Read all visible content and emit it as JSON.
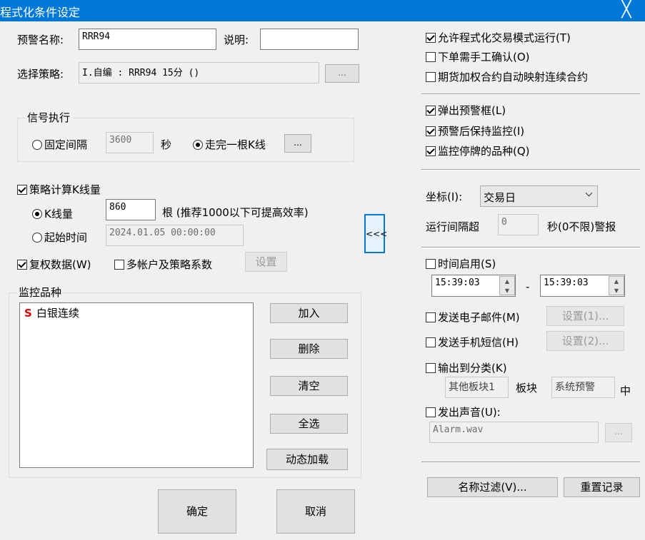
{
  "window": {
    "title": "程式化条件设定",
    "close_glyph": "╳"
  },
  "alert": {
    "name_label": "预警名称:",
    "name_value": "RRR94",
    "desc_label": "说明:",
    "desc_value": "",
    "strategy_label": "选择策略:",
    "strategy_value": "I.自编 : RRR94 15分 ()",
    "browse_label": "..."
  },
  "signal": {
    "group_label": "信号执行",
    "fixed_label": "固定间隔",
    "fixed_value": "3600",
    "unit_sec": "秒",
    "bar_label": "走完一根K线",
    "bar_button": "...",
    "fixed_selected": false,
    "bar_selected": true
  },
  "calc": {
    "checkbox_label": "策略计算K线量",
    "checked": true,
    "kcount_label": "K线量",
    "kcount_value": "860",
    "kcount_hint": "根 (推荐1000以下可提高效率)",
    "kcount_selected": true,
    "start_label": "起始时间",
    "start_value": "2024.01.05 00:00:00",
    "start_selected": false,
    "fq_label": "复权数据(W)",
    "fq_checked": true,
    "multi_label": "多帐户及策略系数",
    "multi_checked": false,
    "settings_label": "设置"
  },
  "monitor": {
    "group_label": "监控品种",
    "items": [
      {
        "badge": "S",
        "name": "白银连续"
      }
    ],
    "add": "加入",
    "delete": "删除",
    "clear": "清空",
    "select_all": "全选",
    "dynamic": "动态加载"
  },
  "actions": {
    "ok": "确定",
    "cancel": "取消",
    "collapse": "<<<"
  },
  "options": {
    "allow_program": {
      "label": "允许程式化交易模式运行(T)",
      "checked": true
    },
    "manual_confirm": {
      "label": "下单需手工确认(O)",
      "checked": false
    },
    "futures_map": {
      "label": "期货加权合约自动映射连续合约",
      "checked": false
    },
    "popup": {
      "label": "弹出预警框(L)",
      "checked": true
    },
    "keep_monitor": {
      "label": "预警后保持监控(I)",
      "checked": true
    },
    "monitor_suspended": {
      "label": "监控停牌的品种(Q)",
      "checked": true
    }
  },
  "axis": {
    "label": "坐标(I):",
    "value": "交易日",
    "interval_label": "运行间隔超",
    "interval_value": "0",
    "interval_suffix": "秒(0不限)警报"
  },
  "time": {
    "label": "时间启用(S)",
    "checked": false,
    "from": "15:39:03",
    "dash": "-",
    "to": "15:39:03"
  },
  "email": {
    "label": "发送电子邮件(M)",
    "checked": false,
    "button": "设置(1)..."
  },
  "sms": {
    "label": "发送手机短信(H)",
    "checked": false,
    "button": "设置(2)..."
  },
  "category": {
    "label": "输出到分类(K)",
    "checked": false,
    "block1": "其他板块1",
    "mid": "板块",
    "block2": "系统预警",
    "suffix": "中"
  },
  "sound": {
    "label": "发出声音(U):",
    "checked": false,
    "file": "Alarm.wav",
    "browse": "..."
  },
  "footer": {
    "filter": "名称过滤(V)...",
    "reset": "重置记录"
  },
  "colors": {
    "title_bg": "#0078d7",
    "badge": "#e00000",
    "window_bg": "#f0f0f0"
  }
}
